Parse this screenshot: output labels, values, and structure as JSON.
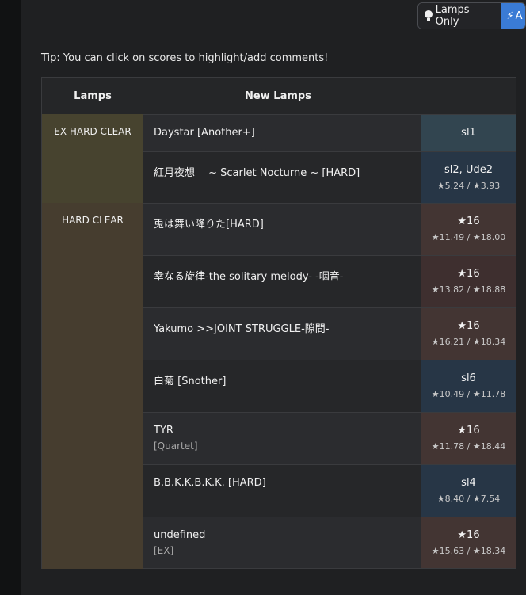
{
  "toolbar": {
    "lamps_only_label": "Lamps Only",
    "other_label": "A"
  },
  "tip": "Tip: You can click on scores to highlight/add comments!",
  "table": {
    "headers": [
      "Lamps",
      "New Lamps"
    ],
    "groups": [
      {
        "label": "EX HARD CLEAR"
      },
      {
        "label": "HARD CLEAR"
      }
    ],
    "rows": [
      {
        "title": "Daystar [Another+]",
        "sub": "",
        "score": "sl1",
        "detail": ""
      },
      {
        "title": "紅月夜想 　~ Scarlet Nocturne ~ [HARD]",
        "sub": "",
        "score": "sl2, Ude2",
        "detail": "★5.24 / ★3.93"
      },
      {
        "title": "兎は舞い降りた[HARD]",
        "sub": "",
        "score": "★16",
        "detail": "★11.49 / ★18.00"
      },
      {
        "title": "幸なる旋律-the solitary melody- -咽音-",
        "sub": "",
        "score": "★16",
        "detail": "★13.82 / ★18.88"
      },
      {
        "title": "Yakumo >>JOINT STRUGGLE-隙間-",
        "sub": "",
        "score": "★16",
        "detail": "★16.21 / ★18.34"
      },
      {
        "title": "白菊 [Snother]",
        "sub": "",
        "score": "sl6",
        "detail": "★10.49 / ★11.78"
      },
      {
        "title": "TYR",
        "sub": "[Quartet]",
        "score": "★16",
        "detail": "★11.78 / ★18.44"
      },
      {
        "title": "B.B.K.K.B.K.K. [HARD]",
        "sub": "",
        "score": "sl4",
        "detail": "★8.40 / ★7.54"
      },
      {
        "title": "undefined",
        "sub": "[EX]",
        "score": "★16",
        "detail": "★15.63 / ★18.34"
      }
    ]
  }
}
